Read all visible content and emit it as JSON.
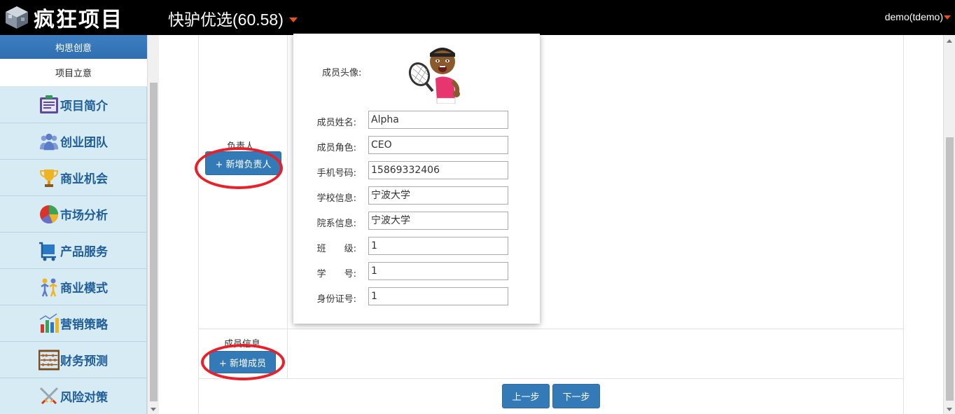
{
  "header": {
    "logo_text": "疯狂项目",
    "project_title": "快驴优选(60.58)",
    "user": "demo(tdemo)"
  },
  "sidebar": {
    "sub_items": [
      {
        "label": "构思创意"
      },
      {
        "label": "项目立意"
      }
    ],
    "items": [
      {
        "label": "项目简介",
        "icon": "document-icon"
      },
      {
        "label": "创业团队",
        "icon": "team-icon"
      },
      {
        "label": "商业机会",
        "icon": "trophy-icon"
      },
      {
        "label": "市场分析",
        "icon": "pie-chart-icon"
      },
      {
        "label": "产品服务",
        "icon": "cart-icon"
      },
      {
        "label": "商业模式",
        "icon": "people-icon"
      },
      {
        "label": "营销策略",
        "icon": "bar-chart-icon"
      },
      {
        "label": "财务预测",
        "icon": "abacus-icon"
      },
      {
        "label": "风险对策",
        "icon": "swords-icon"
      }
    ]
  },
  "leader_section": {
    "label": "负责人",
    "add_button": "+ 新增负责人"
  },
  "member_section": {
    "label": "成员信息",
    "add_button": "+ 新增成员"
  },
  "member_card": {
    "avatar_label": "成员头像:",
    "fields": [
      {
        "label": "成员姓名:",
        "value": "Alpha"
      },
      {
        "label": "成员角色:",
        "value": "CEO"
      },
      {
        "label": "手机号码:",
        "value": "15869332406"
      },
      {
        "label": "学校信息:",
        "value": "宁波大学"
      },
      {
        "label": "院系信息:",
        "value": "宁波大学"
      },
      {
        "label": "班　　级:",
        "value": "1"
      },
      {
        "label": "学　　号:",
        "value": "1"
      },
      {
        "label": "身份证号:",
        "value": "1"
      }
    ]
  },
  "nav": {
    "prev": "上一步",
    "next": "下一步"
  },
  "colors": {
    "primary": "#337ab7",
    "highlight_ring": "#e8202a",
    "sidebar_bg": "#d7ebf4",
    "sidebar_text": "#1f5e99"
  }
}
